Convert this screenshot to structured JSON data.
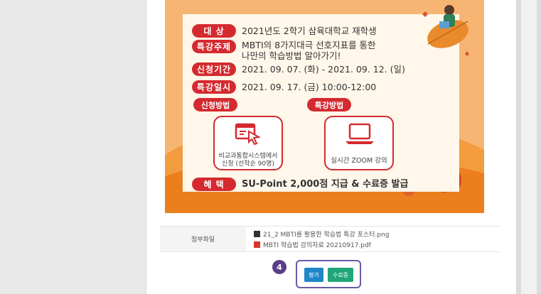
{
  "poster": {
    "rows": [
      {
        "label": "대  상",
        "value": "2021년도 2학기 삼육대학교 재학생"
      },
      {
        "label": "특강주제",
        "value": "MBTI의 8가지대극 선호지표를 통한"
      },
      {
        "label": "신청기간",
        "value": "2021. 09. 07. (화) - 2021. 09. 12. (일)"
      },
      {
        "label": "특강일시",
        "value": "2021. 09. 17. (금) 10:00-12:00"
      },
      {
        "label": "혜  택",
        "value": "SU-Point 2,000점 지급 & 수료증 발급"
      }
    ],
    "topic_line2": "나만의 학습방법 알아가기!",
    "apply_method_label": "신청방법",
    "lecture_method_label": "특강방법",
    "apply_method_line1": "비교과통합시스템에서",
    "apply_method_line2": "신청 (선착순 90명)",
    "lecture_method_text": "실시간 ZOOM 강의"
  },
  "attachments": {
    "label": "첨부파일",
    "files": [
      {
        "name": "21_2 MBTI를 활용한 학습법 특강 포스터.png",
        "icon": "image-file-icon"
      },
      {
        "name": "MBTI 학습법 강의자료 20210917.pdf",
        "icon": "pdf-file-icon"
      }
    ]
  },
  "step_number": "4",
  "buttons": {
    "evaluate": "평가",
    "certificate": "수료증"
  },
  "colors": {
    "poster_red": "#d42a2f",
    "poster_orange": "#f28a2e",
    "step_purple": "#5b3d88",
    "evaluate_blue": "#1f86c8",
    "certificate_green": "#22a57a"
  }
}
